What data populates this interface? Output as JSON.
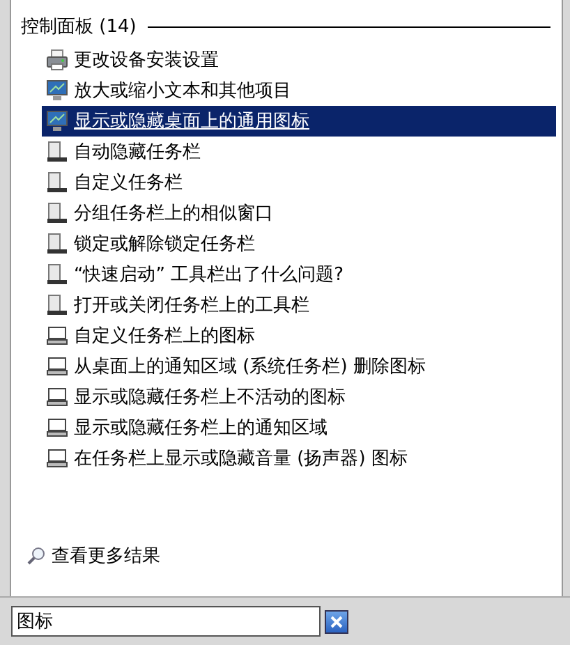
{
  "group": {
    "title": "控制面板 (14)"
  },
  "items": [
    {
      "label": "更改设备安装设置",
      "kind": "printer",
      "selected": false
    },
    {
      "label": "放大或缩小文本和其他项目",
      "kind": "monitor",
      "selected": false
    },
    {
      "label": "显示或隐藏桌面上的通用图标",
      "kind": "monitor",
      "selected": true
    },
    {
      "label": "自动隐藏任务栏",
      "kind": "taskbar",
      "selected": false
    },
    {
      "label": "自定义任务栏",
      "kind": "taskbar",
      "selected": false
    },
    {
      "label": "分组任务栏上的相似窗口",
      "kind": "taskbar",
      "selected": false
    },
    {
      "label": "锁定或解除锁定任务栏",
      "kind": "taskbar",
      "selected": false
    },
    {
      "label": "“快速启动” 工具栏出了什么问题?",
      "kind": "taskbar",
      "selected": false
    },
    {
      "label": "打开或关闭任务栏上的工具栏",
      "kind": "taskbar",
      "selected": false
    },
    {
      "label": "自定义任务栏上的图标",
      "kind": "tray",
      "selected": false
    },
    {
      "label": "从桌面上的通知区域 (系统任务栏) 删除图标",
      "kind": "tray",
      "selected": false
    },
    {
      "label": "显示或隐藏任务栏上不活动的图标",
      "kind": "tray",
      "selected": false
    },
    {
      "label": "显示或隐藏任务栏上的通知区域",
      "kind": "tray",
      "selected": false
    },
    {
      "label": "在任务栏上显示或隐藏音量 (扬声器) 图标",
      "kind": "tray",
      "selected": false
    }
  ],
  "more_results": "查看更多结果",
  "search": {
    "value": "图标"
  }
}
